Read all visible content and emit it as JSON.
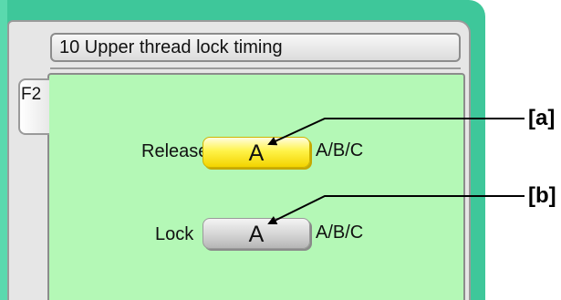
{
  "screen": {
    "title": "10 Upper thread lock timing",
    "tab_label": "F2"
  },
  "rows": [
    {
      "label": "Release",
      "value": "A",
      "options": "A/B/C",
      "state": "selected"
    },
    {
      "label": "Lock",
      "value": "A",
      "options": "A/B/C",
      "state": "normal"
    }
  ],
  "callouts": [
    {
      "label": "[a]"
    },
    {
      "label": "[b]"
    }
  ],
  "colors": {
    "frame": "#3ec79a",
    "panel": "#b4f8b6",
    "selected_button": "#fff34a",
    "normal_button": "#d4d4d4"
  }
}
